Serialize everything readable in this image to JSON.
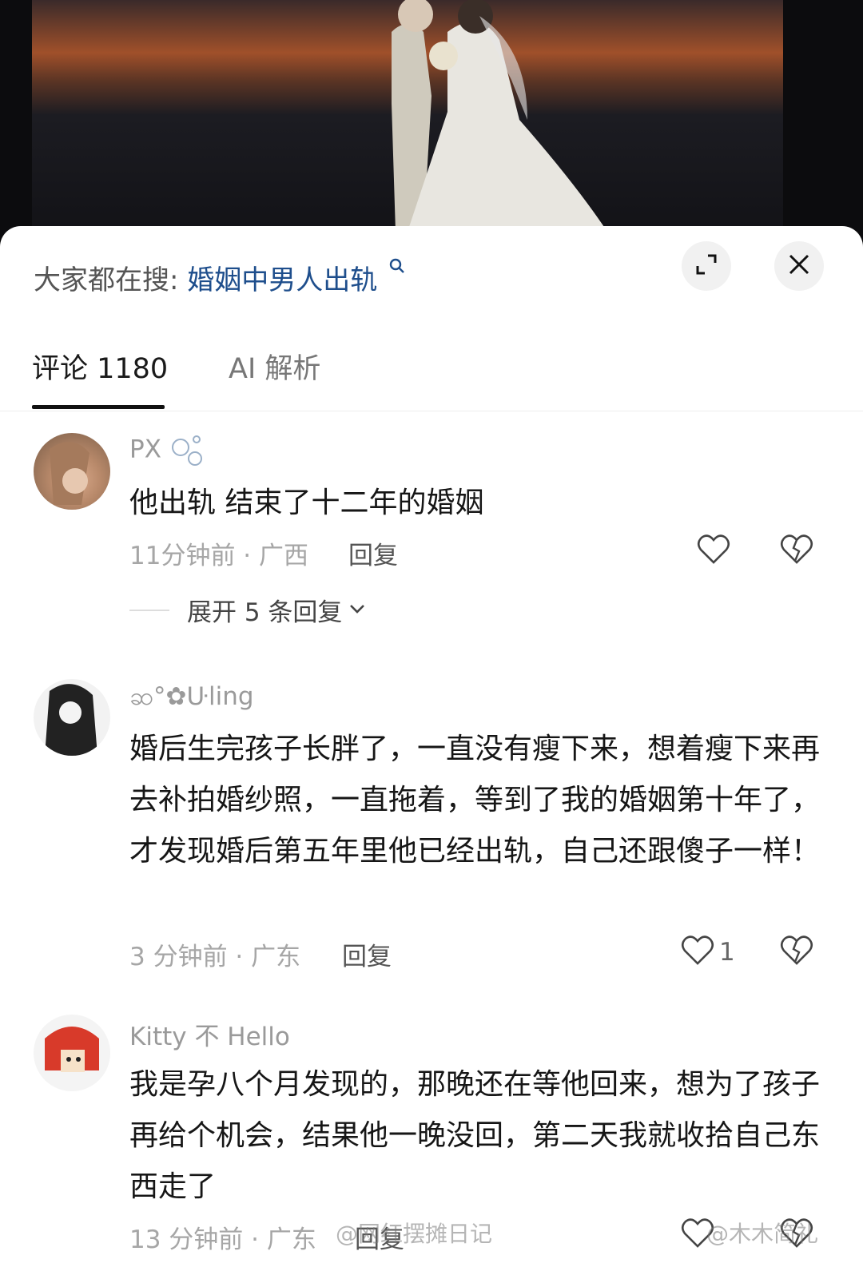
{
  "search_hint": {
    "prefix": "大家都在搜:",
    "keyword": "婚姻中男人出轨"
  },
  "tabs": [
    {
      "label": "评论 1180"
    },
    {
      "label": "AI 解析"
    }
  ],
  "comments": [
    {
      "username": "PX",
      "text": "他出轨 结束了十二年的婚姻",
      "meta": "11分钟前 · 广西",
      "reply_label": "回复",
      "likes": "",
      "expand_label": "展开 5 条回复"
    },
    {
      "username": "ဆ°✿ᑘling",
      "text": "婚后生完孩子长胖了，一直没有瘦下来，想着瘦下来再去补拍婚纱照，一直拖着，等到了我的婚姻第十年了，才发现婚后第五年里他已经出轨，自己还跟傻子一样！",
      "meta": "3 分钟前 · 广东",
      "reply_label": "回复",
      "likes": "1"
    },
    {
      "username": "Kitty 不 Hello",
      "text": "我是孕八个月发现的，那晚还在等他回来，想为了孩子再给个机会，结果他一晚没回，第二天我就收拾自己东西走了",
      "meta": "13 分钟前 · 广东",
      "reply_label": "回复",
      "likes": ""
    }
  ],
  "watermarks": [
    "@网红摆摊日记",
    "@木木简礼"
  ],
  "icons": {
    "search": "magnifier-icon",
    "expand": "expand-arrows-icon",
    "close": "close-icon",
    "like": "heart-outline-icon",
    "dislike": "broken-heart-icon",
    "chevron": "chevron-down-icon"
  }
}
